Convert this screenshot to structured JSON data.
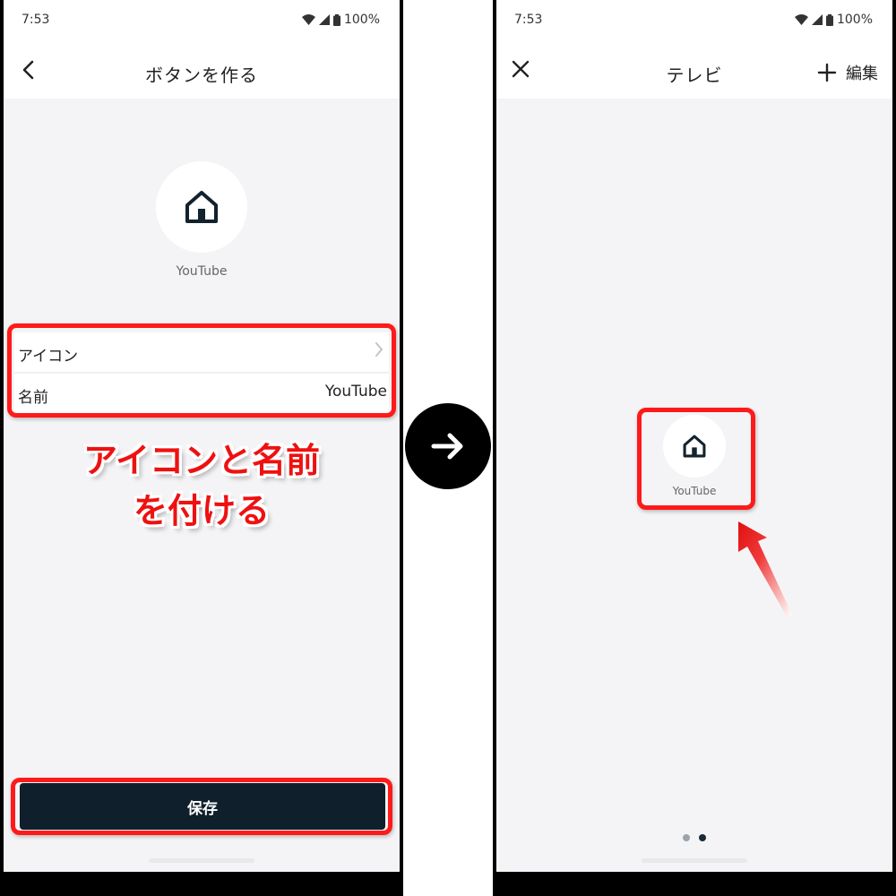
{
  "colors": {
    "highlight": "#ff1a1a",
    "annotation_text": "#ee1111",
    "primary_button": "#0f1f2b",
    "screen_background": "#f4f4f6",
    "dot_active": "#1a2a36",
    "dot_inactive": "#9aa4ab"
  },
  "status_bar": {
    "time": "7:53",
    "battery": "100%",
    "icons": [
      "wifi-icon",
      "signal-icon",
      "battery-icon"
    ]
  },
  "left_screen": {
    "title": "ボタンを作る",
    "back_icon": "chevron-left-icon",
    "preview": {
      "icon": "home-icon",
      "label": "YouTube"
    },
    "settings": {
      "icon_row_label": "アイコン",
      "icon_row_chevron": "chevron-right-icon",
      "name_row_label": "名前",
      "name_row_value": "YouTube"
    },
    "save_label": "保存",
    "annotation": {
      "line1": "アイコンと名前",
      "line2": "を付ける"
    }
  },
  "transition": {
    "icon": "arrow-right-icon"
  },
  "right_screen": {
    "title": "テレビ",
    "close_icon": "close-icon",
    "add_icon": "plus-icon",
    "edit_label": "編集",
    "button": {
      "icon": "home-icon",
      "label": "YouTube"
    },
    "pager": {
      "pages": 2,
      "current": 2
    }
  }
}
